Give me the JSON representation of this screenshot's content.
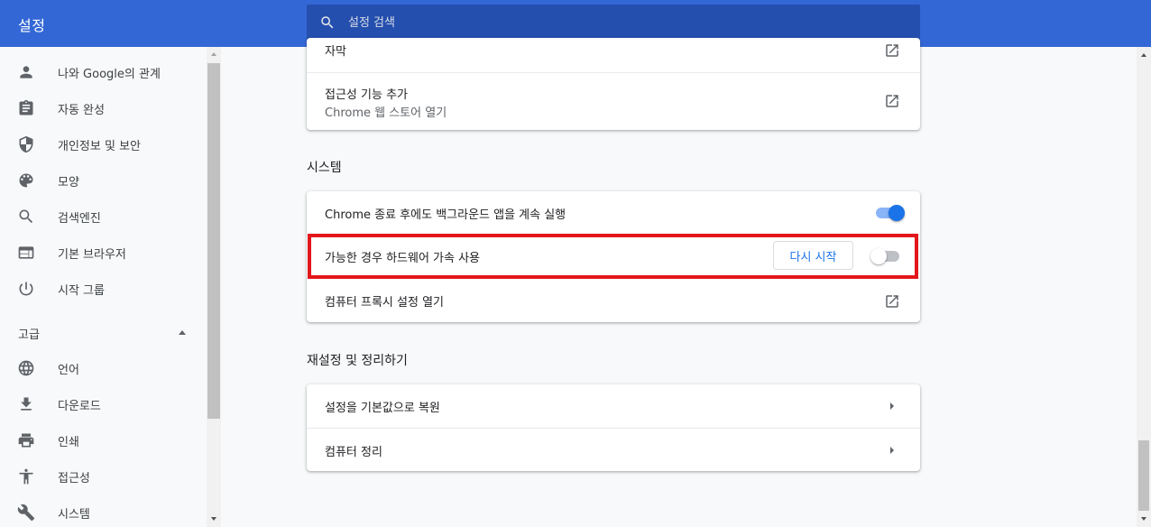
{
  "header": {
    "title": "설정",
    "search_placeholder": "설정 검색",
    "search_icon": "search-icon"
  },
  "sidebar": {
    "items": [
      {
        "label": "나와 Google의 관계",
        "icon": "person-icon"
      },
      {
        "label": "자동 완성",
        "icon": "clipboard-icon"
      },
      {
        "label": "개인정보 및 보안",
        "icon": "shield-icon"
      },
      {
        "label": "모양",
        "icon": "palette-icon"
      },
      {
        "label": "검색엔진",
        "icon": "search-icon"
      },
      {
        "label": "기본 브라우저",
        "icon": "browser-icon"
      },
      {
        "label": "시작 그룹",
        "icon": "power-icon"
      }
    ],
    "advanced_label": "고급",
    "advanced_items": [
      {
        "label": "언어",
        "icon": "globe-icon"
      },
      {
        "label": "다운로드",
        "icon": "download-icon"
      },
      {
        "label": "인쇄",
        "icon": "printer-icon"
      },
      {
        "label": "접근성",
        "icon": "accessibility-icon"
      },
      {
        "label": "시스템",
        "icon": "wrench-icon"
      }
    ]
  },
  "main": {
    "accessibility_card": {
      "partial_row_label": "자막",
      "add_features_title": "접근성 기능 추가",
      "add_features_subtitle": "Chrome 웹 스토어 열기"
    },
    "system_section": {
      "title": "시스템",
      "background_apps_label": "Chrome 종료 후에도 백그라운드 앱을 계속 실행",
      "background_apps_enabled": true,
      "hardware_accel_label": "가능한 경우 하드웨어 가속 사용",
      "hardware_accel_enabled": false,
      "restart_button": "다시 시작",
      "proxy_label": "컴퓨터 프록시 설정 열기"
    },
    "reset_section": {
      "title": "재설정 및 정리하기",
      "restore_label": "설정을 기본값으로 복원",
      "cleanup_label": "컴퓨터 정리"
    }
  },
  "colors": {
    "header_bg": "#3367d6",
    "search_bg": "#254fae",
    "toggle_on": "#1a73e8",
    "highlight_border": "#e3161b"
  }
}
